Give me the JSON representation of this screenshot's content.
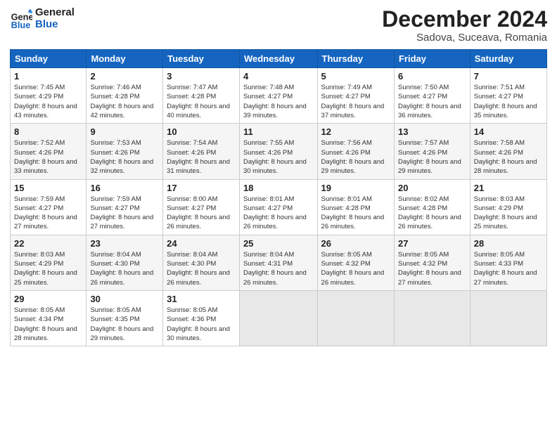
{
  "header": {
    "logo_line1": "General",
    "logo_line2": "Blue",
    "month": "December 2024",
    "location": "Sadova, Suceava, Romania"
  },
  "weekdays": [
    "Sunday",
    "Monday",
    "Tuesday",
    "Wednesday",
    "Thursday",
    "Friday",
    "Saturday"
  ],
  "weeks": [
    [
      {
        "day": 1,
        "sunrise": "7:45 AM",
        "sunset": "4:29 PM",
        "daylight": "8 hours and 43 minutes."
      },
      {
        "day": 2,
        "sunrise": "7:46 AM",
        "sunset": "4:28 PM",
        "daylight": "8 hours and 42 minutes."
      },
      {
        "day": 3,
        "sunrise": "7:47 AM",
        "sunset": "4:28 PM",
        "daylight": "8 hours and 40 minutes."
      },
      {
        "day": 4,
        "sunrise": "7:48 AM",
        "sunset": "4:27 PM",
        "daylight": "8 hours and 39 minutes."
      },
      {
        "day": 5,
        "sunrise": "7:49 AM",
        "sunset": "4:27 PM",
        "daylight": "8 hours and 37 minutes."
      },
      {
        "day": 6,
        "sunrise": "7:50 AM",
        "sunset": "4:27 PM",
        "daylight": "8 hours and 36 minutes."
      },
      {
        "day": 7,
        "sunrise": "7:51 AM",
        "sunset": "4:27 PM",
        "daylight": "8 hours and 35 minutes."
      }
    ],
    [
      {
        "day": 8,
        "sunrise": "7:52 AM",
        "sunset": "4:26 PM",
        "daylight": "8 hours and 33 minutes."
      },
      {
        "day": 9,
        "sunrise": "7:53 AM",
        "sunset": "4:26 PM",
        "daylight": "8 hours and 32 minutes."
      },
      {
        "day": 10,
        "sunrise": "7:54 AM",
        "sunset": "4:26 PM",
        "daylight": "8 hours and 31 minutes."
      },
      {
        "day": 11,
        "sunrise": "7:55 AM",
        "sunset": "4:26 PM",
        "daylight": "8 hours and 30 minutes."
      },
      {
        "day": 12,
        "sunrise": "7:56 AM",
        "sunset": "4:26 PM",
        "daylight": "8 hours and 29 minutes."
      },
      {
        "day": 13,
        "sunrise": "7:57 AM",
        "sunset": "4:26 PM",
        "daylight": "8 hours and 29 minutes."
      },
      {
        "day": 14,
        "sunrise": "7:58 AM",
        "sunset": "4:26 PM",
        "daylight": "8 hours and 28 minutes."
      }
    ],
    [
      {
        "day": 15,
        "sunrise": "7:59 AM",
        "sunset": "4:27 PM",
        "daylight": "8 hours and 27 minutes."
      },
      {
        "day": 16,
        "sunrise": "7:59 AM",
        "sunset": "4:27 PM",
        "daylight": "8 hours and 27 minutes."
      },
      {
        "day": 17,
        "sunrise": "8:00 AM",
        "sunset": "4:27 PM",
        "daylight": "8 hours and 26 minutes."
      },
      {
        "day": 18,
        "sunrise": "8:01 AM",
        "sunset": "4:27 PM",
        "daylight": "8 hours and 26 minutes."
      },
      {
        "day": 19,
        "sunrise": "8:01 AM",
        "sunset": "4:28 PM",
        "daylight": "8 hours and 26 minutes."
      },
      {
        "day": 20,
        "sunrise": "8:02 AM",
        "sunset": "4:28 PM",
        "daylight": "8 hours and 26 minutes."
      },
      {
        "day": 21,
        "sunrise": "8:03 AM",
        "sunset": "4:29 PM",
        "daylight": "8 hours and 25 minutes."
      }
    ],
    [
      {
        "day": 22,
        "sunrise": "8:03 AM",
        "sunset": "4:29 PM",
        "daylight": "8 hours and 25 minutes."
      },
      {
        "day": 23,
        "sunrise": "8:04 AM",
        "sunset": "4:30 PM",
        "daylight": "8 hours and 26 minutes."
      },
      {
        "day": 24,
        "sunrise": "8:04 AM",
        "sunset": "4:30 PM",
        "daylight": "8 hours and 26 minutes."
      },
      {
        "day": 25,
        "sunrise": "8:04 AM",
        "sunset": "4:31 PM",
        "daylight": "8 hours and 26 minutes."
      },
      {
        "day": 26,
        "sunrise": "8:05 AM",
        "sunset": "4:32 PM",
        "daylight": "8 hours and 26 minutes."
      },
      {
        "day": 27,
        "sunrise": "8:05 AM",
        "sunset": "4:32 PM",
        "daylight": "8 hours and 27 minutes."
      },
      {
        "day": 28,
        "sunrise": "8:05 AM",
        "sunset": "4:33 PM",
        "daylight": "8 hours and 27 minutes."
      }
    ],
    [
      {
        "day": 29,
        "sunrise": "8:05 AM",
        "sunset": "4:34 PM",
        "daylight": "8 hours and 28 minutes."
      },
      {
        "day": 30,
        "sunrise": "8:05 AM",
        "sunset": "4:35 PM",
        "daylight": "8 hours and 29 minutes."
      },
      {
        "day": 31,
        "sunrise": "8:05 AM",
        "sunset": "4:36 PM",
        "daylight": "8 hours and 30 minutes."
      },
      null,
      null,
      null,
      null
    ]
  ]
}
